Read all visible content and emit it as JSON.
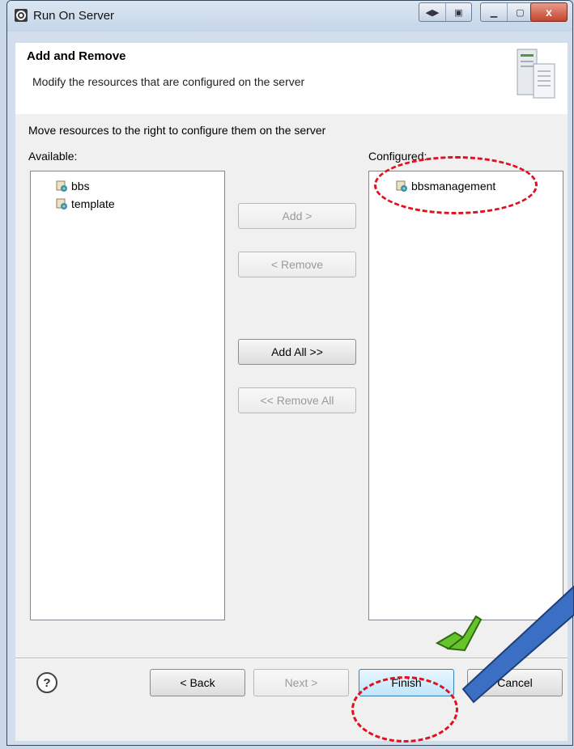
{
  "window": {
    "title": "Run On Server",
    "buttons": [
      "restore-arrows",
      "pin",
      "minimize",
      "maximize",
      "close"
    ],
    "close_glyph": "x"
  },
  "header": {
    "title": "Add and Remove",
    "description": "Modify the resources that are configured on the server"
  },
  "body": {
    "instruction": "Move resources to the right to configure them on the server",
    "available_label": "Available:",
    "configured_label": "Configured:",
    "available_items": [
      "bbs",
      "template"
    ],
    "configured_items": [
      "bbsmanagement"
    ]
  },
  "buttons": {
    "add": "Add >",
    "remove": "< Remove",
    "add_all": "Add All >>",
    "remove_all": "<< Remove All",
    "back": "< Back",
    "next": "Next >",
    "finish": "Finish",
    "cancel": "Cancel"
  },
  "help_glyph": "?",
  "annotations": {
    "highlight_color": "#e0101e",
    "arrow_color": "#3a6fc4",
    "check_color": "#66c32a"
  },
  "icons": {
    "project": "web-project-icon",
    "server": "server-icon"
  }
}
